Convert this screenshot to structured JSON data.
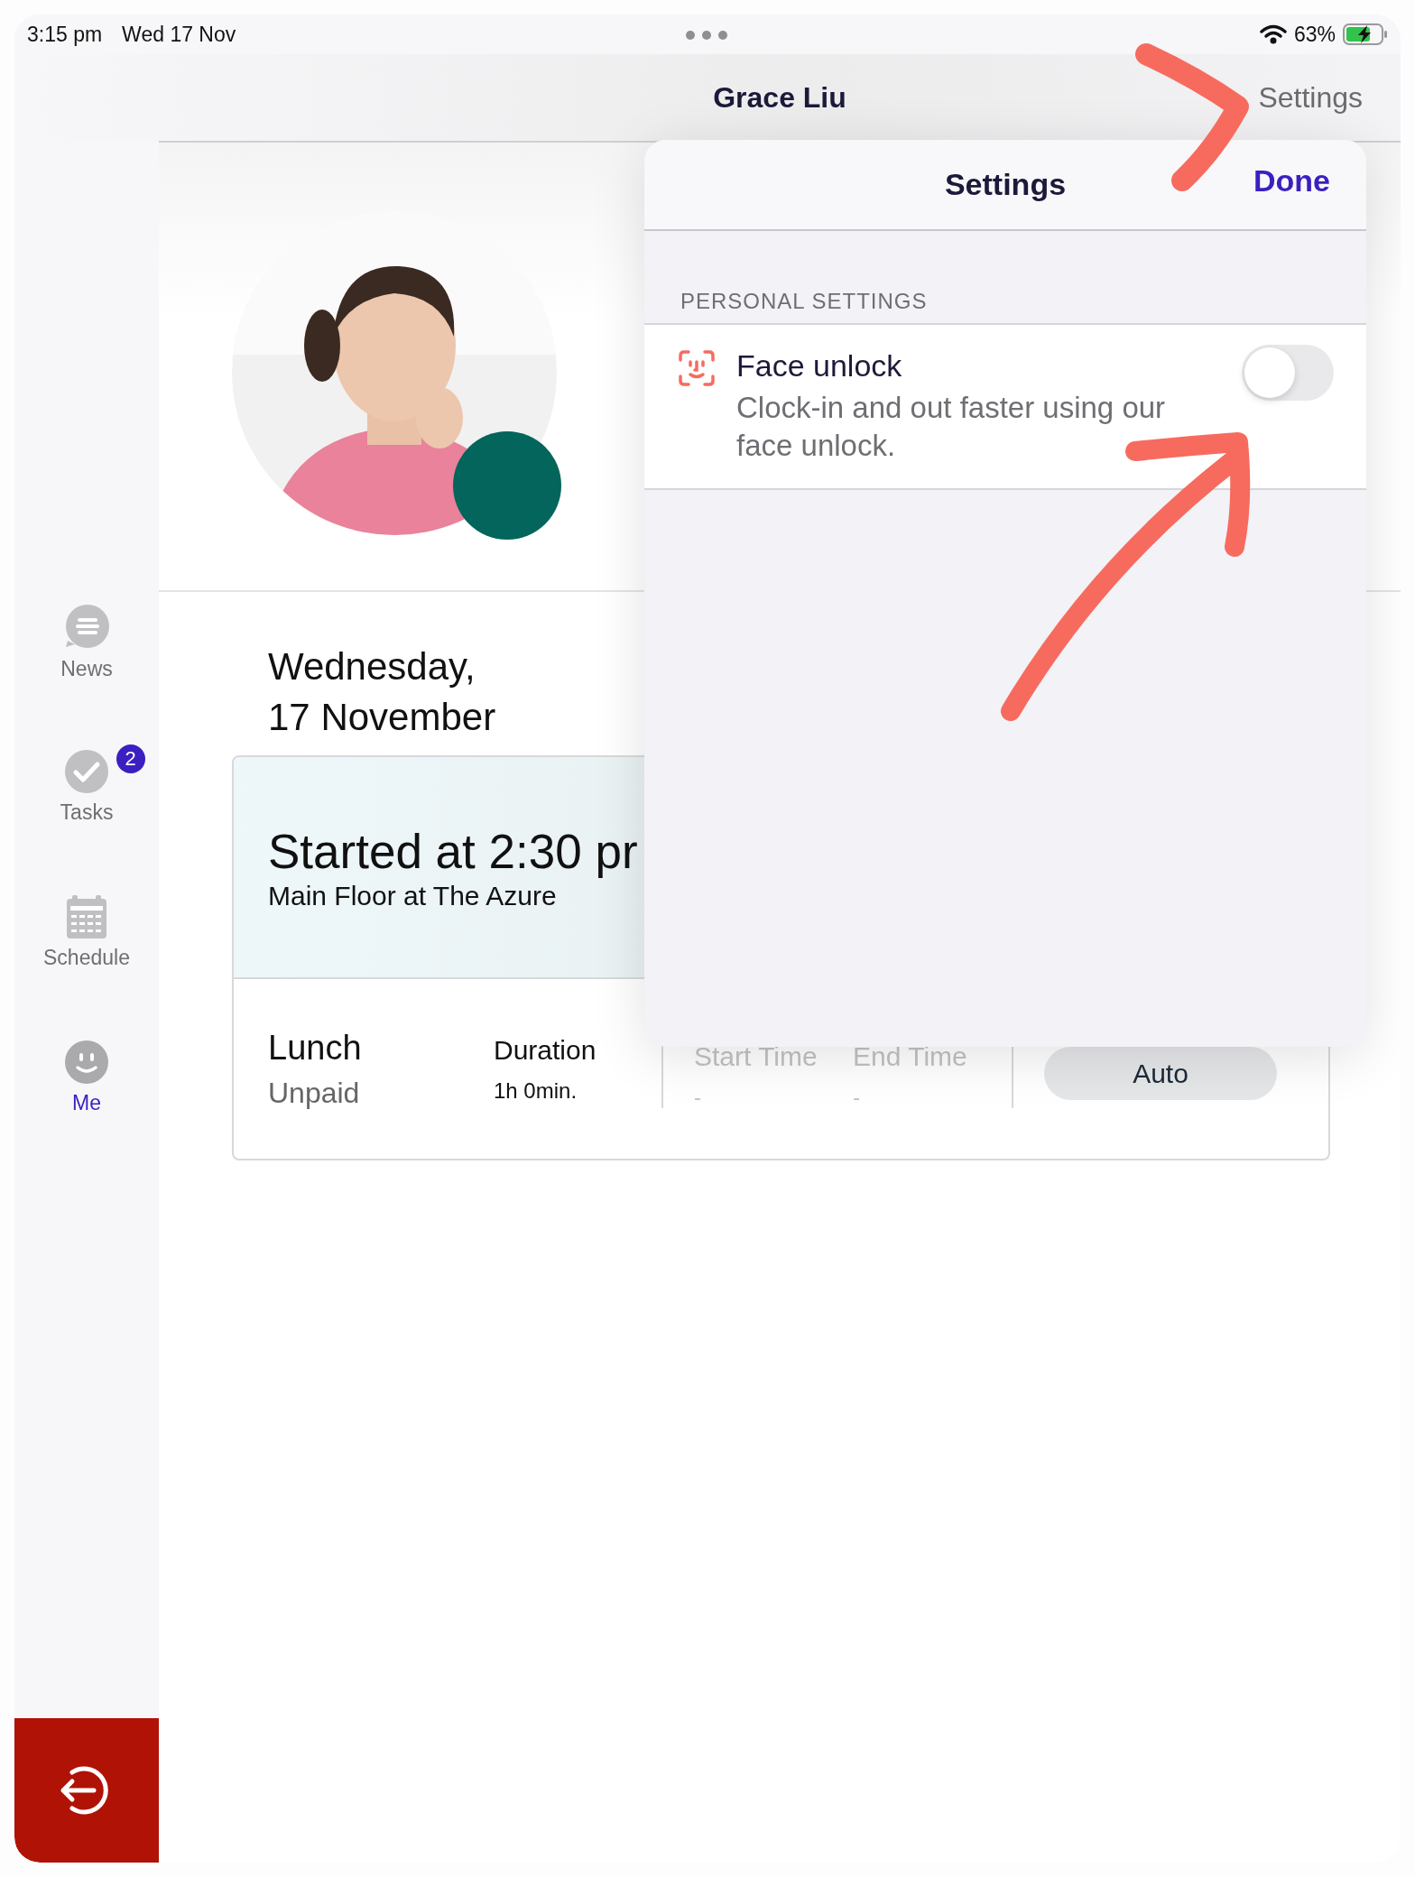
{
  "status_bar": {
    "time": "3:15 pm",
    "date": "Wed 17 Nov",
    "battery": "63%"
  },
  "nav_bar": {
    "title": "Grace Liu",
    "settings_button": "Settings"
  },
  "sidebar": {
    "items": [
      {
        "label": "News",
        "kind": "news",
        "selected": false
      },
      {
        "label": "Tasks",
        "kind": "tasks",
        "selected": false,
        "badge": "2"
      },
      {
        "label": "Schedule",
        "kind": "schedule",
        "selected": false
      },
      {
        "label": "Me",
        "kind": "me",
        "selected": true
      }
    ]
  },
  "date_lines": [
    "Wednesday,",
    "17 November"
  ],
  "shift": {
    "title": "Started at 2:30 pr",
    "location": "Main Floor at The Azure"
  },
  "break": {
    "name": "Lunch",
    "type": "Unpaid",
    "columns": [
      {
        "label": "Duration",
        "value": "1h 0min.",
        "muted": false
      },
      {
        "label": "Start Time",
        "value": "-",
        "muted": true
      },
      {
        "label": "End Time",
        "value": "-",
        "muted": true
      }
    ],
    "button": "Auto"
  },
  "settings_popover": {
    "title": "Settings",
    "done": "Done",
    "section": "PERSONAL SETTINGS",
    "rows": [
      {
        "title": "Face unlock",
        "description": "Clock-in and out faster using our face unlock.",
        "on": false
      }
    ]
  }
}
